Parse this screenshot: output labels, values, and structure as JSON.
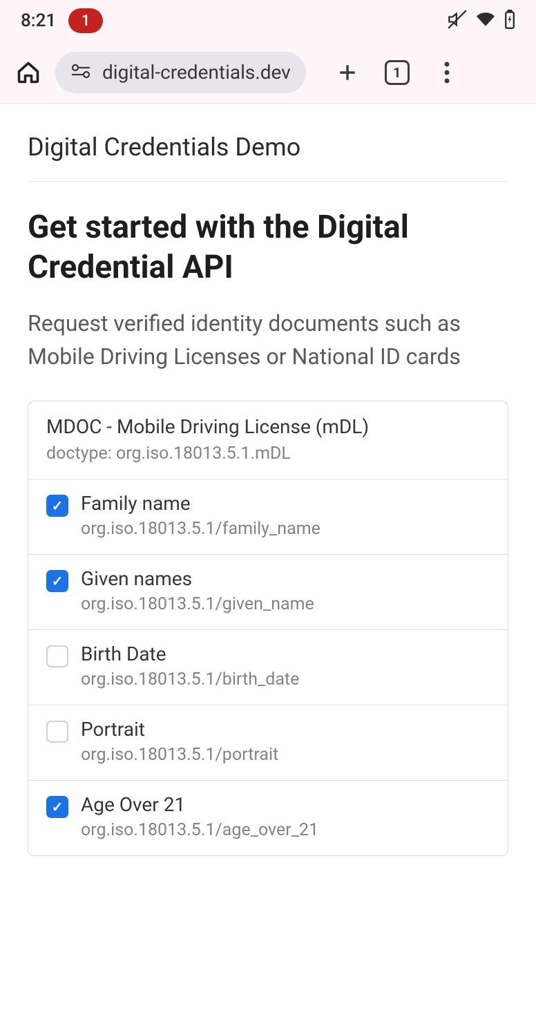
{
  "status": {
    "time": "8:21",
    "notif_count": "1"
  },
  "browser": {
    "url": "digital-credentials.dev",
    "tab_count": "1"
  },
  "page": {
    "title": "Digital Credentials Demo",
    "heading": "Get started with the Digital Credential API",
    "subtitle": "Request verified identity documents such as Mobile Driving Licenses or National ID cards"
  },
  "card": {
    "title": "MDOC - Mobile Driving License (mDL)",
    "subtitle": "doctype: org.iso.18013.5.1.mDL",
    "fields": [
      {
        "label": "Family name",
        "sub": "org.iso.18013.5.1/family_name",
        "checked": true
      },
      {
        "label": "Given names",
        "sub": "org.iso.18013.5.1/given_name",
        "checked": true
      },
      {
        "label": "Birth Date",
        "sub": "org.iso.18013.5.1/birth_date",
        "checked": false
      },
      {
        "label": "Portrait",
        "sub": "org.iso.18013.5.1/portrait",
        "checked": false
      },
      {
        "label": "Age Over 21",
        "sub": "org.iso.18013.5.1/age_over_21",
        "checked": true
      }
    ]
  }
}
